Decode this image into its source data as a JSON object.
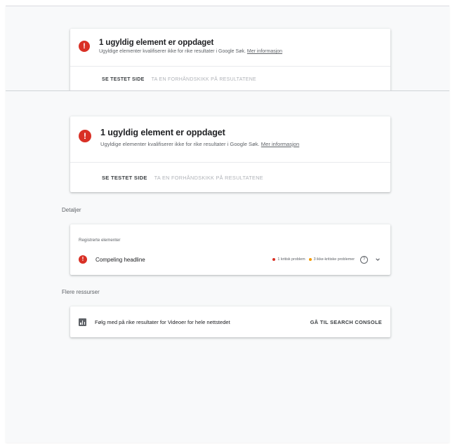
{
  "alert": {
    "icon": "error-icon",
    "icon_glyph": "!",
    "title": "1 ugyldig element er oppdaget",
    "description": "Ugyldige elementer kvalifiserer ikke for rike resultater i Google Søk.",
    "more_link": "Mer informasjon",
    "primary_action": "SE TESTET SIDE",
    "secondary_action": "TA EN FORHÅNDSKIKK PÅ RESULTATENE"
  },
  "details": {
    "section_label": "Detaljer",
    "card_title": "Registrerte elementer",
    "item": {
      "name": "Compeling headline",
      "critical": "1 kritisk problem",
      "noncritical": "3 ikke-kritiske problemer",
      "help_glyph": "?"
    }
  },
  "resources": {
    "section_label": "Flere ressurser",
    "text": "Følg med på rike resultater for Videoer for hele nettstedet",
    "link": "GÅ TIL SEARCH CONSOLE"
  },
  "colors": {
    "error": "#d93025",
    "warning": "#f29900",
    "background": "#f8f9fa"
  }
}
